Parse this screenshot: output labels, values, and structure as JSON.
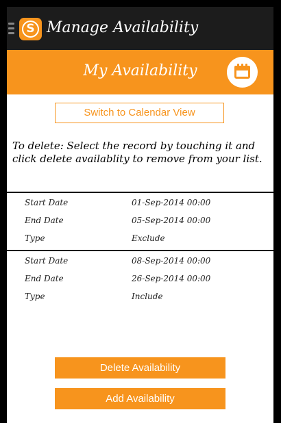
{
  "app_bar": {
    "title": "Manage Availability",
    "logo_letter": "S"
  },
  "header": {
    "title": "My Availability"
  },
  "switch_button": {
    "label": "Switch to Calendar View"
  },
  "instructions": "To delete: Select the record by touching it and click delete availablity to remove from your list.",
  "records": [
    {
      "start_label": "Start Date",
      "start": "01-Sep-2014 00:00",
      "end_label": "End Date",
      "end": "05-Sep-2014 00:00",
      "type_label": "Type",
      "type": "Exclude"
    },
    {
      "start_label": "Start Date",
      "start": "08-Sep-2014 00:00",
      "end_label": "End Date",
      "end": "26-Sep-2014 00:00",
      "type_label": "Type",
      "type": "Include"
    }
  ],
  "buttons": {
    "delete": "Delete Availability",
    "add": "Add Availability"
  },
  "colors": {
    "accent": "#f7941d",
    "app_bar": "#1c1c1c"
  },
  "icons": {
    "menu": "menu-icon",
    "logo": "app-logo-icon",
    "calendar": "calendar-icon"
  }
}
